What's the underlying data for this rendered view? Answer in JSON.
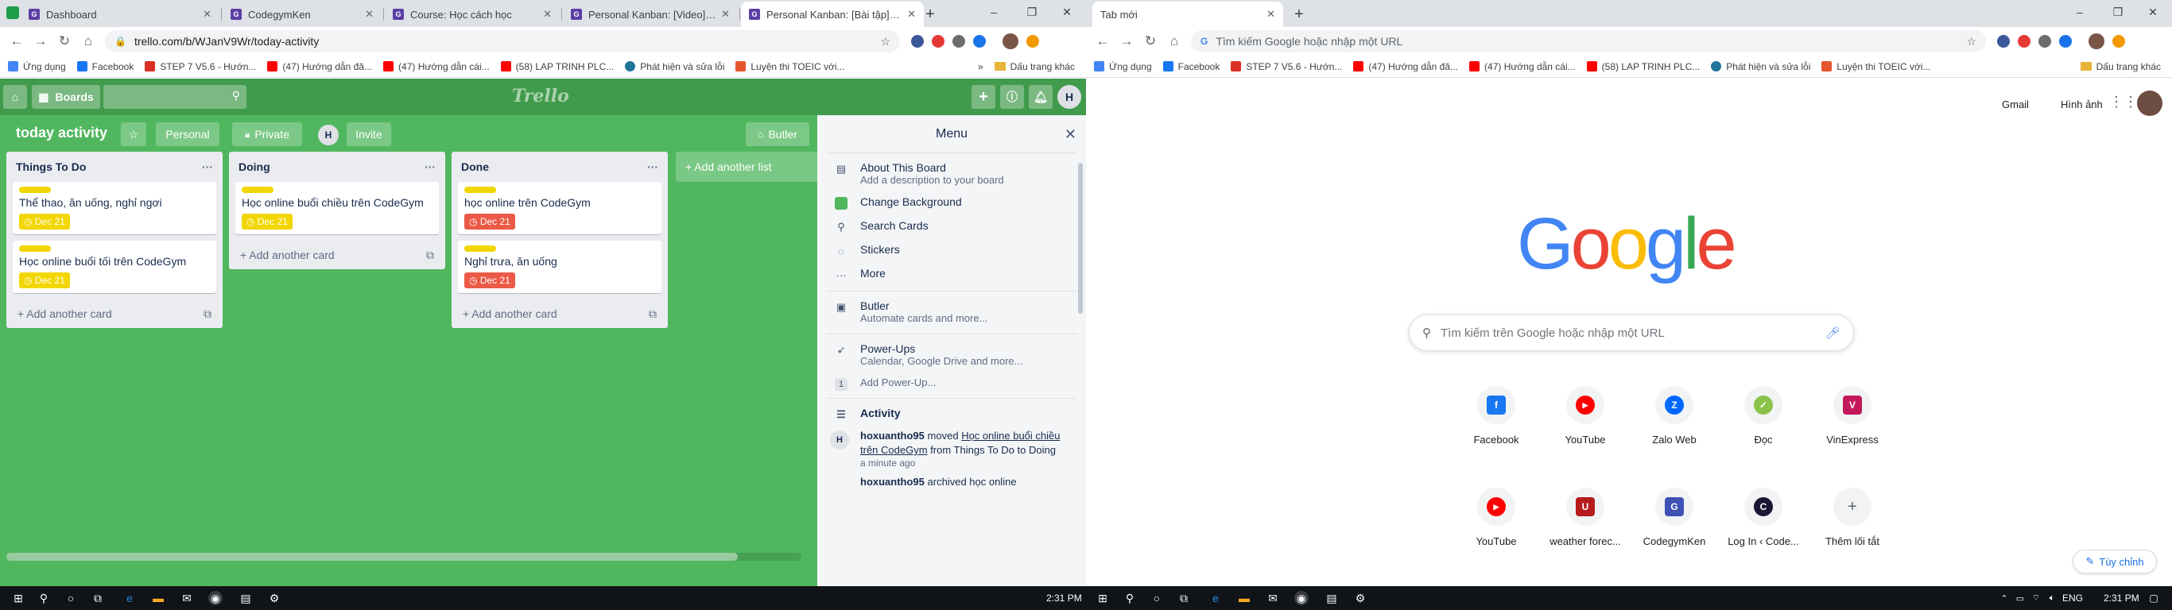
{
  "left_window": {
    "tabs": [
      {
        "title": "Dashboard",
        "favicon": "trello-icon",
        "color": "#5b3fa5"
      },
      {
        "title": "CodegymKen",
        "favicon": "codegym-icon",
        "color": "#5b3fa5"
      },
      {
        "title": "Course: Học cách học",
        "favicon": "codegym-icon",
        "color": "#5b3fa5"
      },
      {
        "title": "Personal Kanban: [Video] Sử dụ",
        "favicon": "codegym-icon",
        "color": "#5b3fa5"
      },
      {
        "title": "Personal Kanban: [Bài tập] Sử d",
        "favicon": "codegym-icon",
        "color": "#5b3fa5"
      }
    ],
    "url": "trello.com/b/WJanV9Wr/today-activity",
    "bookmarks": [
      {
        "label": "Ứng dụng",
        "icon": "apps-grid-icon"
      },
      {
        "label": "Facebook",
        "icon": "facebook-icon",
        "color": "#1877f2"
      },
      {
        "label": "STEP 7 V5.6 - Hướn...",
        "icon": "step7-icon",
        "color": "#d93025"
      },
      {
        "label": "(47) Hướng dẫn đă...",
        "icon": "youtube-icon",
        "color": "#ff0000"
      },
      {
        "label": "(47) Hướng dẫn cái...",
        "icon": "youtube-icon",
        "color": "#ff0000"
      },
      {
        "label": "(58) LAP TRINH PLC...",
        "icon": "youtube-icon",
        "color": "#ff0000"
      },
      {
        "label": "Phát hiện và sửa lỗi",
        "icon": "wordpress-icon",
        "color": "#21759b"
      },
      {
        "label": "Luyện thi TOEIC với...",
        "icon": "toeic-icon",
        "color": "#e4572e"
      }
    ],
    "bookmarks_more": "»",
    "other_bookmarks": "Dấu trang khác"
  },
  "trello": {
    "nav": {
      "boards_label": "Boards",
      "logo": "Trello",
      "avatar": "H"
    },
    "board": {
      "name": "today activity",
      "team_label": "Personal",
      "visibility_label": "Private",
      "member_avatar": "H",
      "invite_label": "Invite",
      "butler_label": "Butler"
    },
    "lists": [
      {
        "title": "Things To Do",
        "cards": [
          {
            "text": "Thể thao, ăn uống, nghỉ ngơi",
            "due": "Dec 21",
            "due_state": "yellow"
          },
          {
            "text": "Học online buổi tối trên CodeGym",
            "due": "Dec 21",
            "due_state": "yellow"
          }
        ],
        "add_card": "Add another card"
      },
      {
        "title": "Doing",
        "cards": [
          {
            "text": "Học online buổi chiều trên CodeGym",
            "due": "Dec 21",
            "due_state": "yellow"
          }
        ],
        "add_card": "Add another card"
      },
      {
        "title": "Done",
        "cards": [
          {
            "text": "học online trên CodeGym",
            "due": "Dec 21",
            "due_state": "red"
          },
          {
            "text": "Nghỉ trưa, ăn uống",
            "due": "Dec 21",
            "due_state": "red"
          }
        ],
        "add_card": "Add another card"
      }
    ],
    "add_list": "+ Add another list",
    "menu": {
      "title": "Menu",
      "about_title": "About This Board",
      "about_sub": "Add a description to your board",
      "change_background": "Change Background",
      "search_cards": "Search Cards",
      "stickers": "Stickers",
      "more": "More",
      "butler_title": "Butler",
      "butler_sub": "Automate cards and more...",
      "powerups_title": "Power-Ups",
      "powerups_sub": "Calendar, Google Drive and more...",
      "add_powerup_count": "1",
      "add_powerup": "Add Power-Up...",
      "activity_title": "Activity",
      "activity": [
        {
          "user": "hoxuantho95",
          "action": "moved",
          "card": "Học online buổi chiều trên CodeGym",
          "detail": "from Things To Do to Doing",
          "time": "a minute ago"
        },
        {
          "user": "hoxuantho95",
          "action": "archived học online",
          "card": "",
          "detail": "",
          "time": ""
        }
      ]
    },
    "colors": {
      "board_bg": "#51b75f",
      "nav_bg": "#419b4c",
      "label_yellow": "#f2d600",
      "due_red": "#eb5a46",
      "change_bg_swatch": "#51b75f"
    }
  },
  "right_window": {
    "tab_title": "Tab mới",
    "omnibox_placeholder": "Tìm kiếm Google hoặc nhập một URL",
    "bookmarks": [
      {
        "label": "Ứng dụng"
      },
      {
        "label": "Facebook"
      },
      {
        "label": "STEP 7 V5.6 - Hướn..."
      },
      {
        "label": "(47) Hướng dẫn đă..."
      },
      {
        "label": "(47) Hướng dẫn cái..."
      },
      {
        "label": "(58) LAP TRINH PLC..."
      },
      {
        "label": "Phát hiện và sửa lỗi"
      },
      {
        "label": "Luyện thi TOEIC với..."
      }
    ],
    "other_bookmarks": "Dấu trang khác",
    "gmail": "Gmail",
    "images": "Hình ảnh",
    "search_placeholder": "Tìm kiếm trên Google hoặc nhập một URL",
    "shortcuts": [
      {
        "label": "Facebook",
        "icon": "facebook-icon",
        "color": "#1877f2",
        "glyph": "f"
      },
      {
        "label": "YouTube",
        "icon": "youtube-icon",
        "color": "#ff0000",
        "glyph": "▶"
      },
      {
        "label": "Zalo Web",
        "icon": "zalo-icon",
        "color": "#0068ff",
        "glyph": "Z"
      },
      {
        "label": "Đọc",
        "icon": "reader-icon",
        "color": "#8bc34a",
        "glyph": "✓"
      },
      {
        "label": "VinExpress",
        "icon": "vinexpress-icon",
        "color": "#c2185b",
        "glyph": "V"
      },
      {
        "label": "YouTube",
        "icon": "youtube-icon",
        "color": "#ff0000",
        "glyph": "▶"
      },
      {
        "label": "weather forec...",
        "icon": "weather-icon",
        "color": "#b71c1c",
        "glyph": "U"
      },
      {
        "label": "CodegymKen",
        "icon": "codegym-icon",
        "color": "#3f51b5",
        "glyph": "G"
      },
      {
        "label": "Log In ‹ Code...",
        "icon": "login-icon",
        "color": "#1c1533",
        "glyph": "C"
      },
      {
        "label": "Thêm lối tắt",
        "icon": "plus-icon",
        "color": "#5f6368",
        "glyph": "+"
      }
    ],
    "customize": "Tùy chỉnh"
  },
  "taskbar": {
    "left_time": "2:31 PM",
    "right_lang": "ENG",
    "right_time": "2:31 PM"
  }
}
